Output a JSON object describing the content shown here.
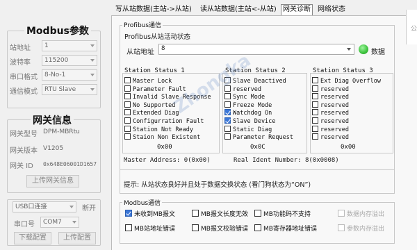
{
  "left": {
    "modbus_group": {
      "title": "Modbus参数",
      "fields": [
        {
          "label": "站地址",
          "value": "1"
        },
        {
          "label": "波特率",
          "value": "115200"
        },
        {
          "label": "串口格式",
          "value": "8-No-1"
        },
        {
          "label": "通信模式",
          "value": "RTU Slave"
        }
      ]
    },
    "gateway_group": {
      "title": "网关信息",
      "fields": [
        {
          "label": "网关型号",
          "value": "DPM-MBRtu"
        },
        {
          "label": "网关版本",
          "value": "V1205"
        },
        {
          "label": "网关 ID",
          "value": "0x648E06001D1657"
        }
      ],
      "upload_button": "上传网关信息"
    },
    "connection": {
      "connect_type": "USB口连接",
      "disconnect_button": "断开",
      "com_label": "串口号",
      "com_value": "COM7",
      "download_button": "下载配置",
      "upload_button": "上传配置"
    }
  },
  "tabs": [
    {
      "label": "写从站数据(主站->从站)"
    },
    {
      "label": "读从站数据(主站<-从站)"
    },
    {
      "label": "网关诊断"
    },
    {
      "label": "网络状态"
    }
  ],
  "profibus": {
    "title": "Profibus通信",
    "activity_title": "Profibus从站活动状态",
    "slave_addr_label": "从站地址",
    "slave_addr_value": "8",
    "data_label": "数据",
    "led_color": "#3cc23c",
    "status1": {
      "title": "Station Status 1",
      "items": [
        {
          "label": "Master Lock",
          "checked": false
        },
        {
          "label": "Parameter Fault",
          "checked": false
        },
        {
          "label": "Invalid Slave Response",
          "checked": false
        },
        {
          "label": "No Supported",
          "checked": false
        },
        {
          "label": "Extended Diag",
          "checked": false
        },
        {
          "label": "Configurration Fault",
          "checked": false
        },
        {
          "label": "Station Not Ready",
          "checked": false
        },
        {
          "label": "Staion Non Existent",
          "checked": false
        }
      ],
      "hex": "0x00"
    },
    "status2": {
      "title": "Station Status 2",
      "items": [
        {
          "label": "Slave Deactived",
          "checked": false
        },
        {
          "label": "reserved",
          "checked": false
        },
        {
          "label": "Sync Mode",
          "checked": false
        },
        {
          "label": "Freeze Mode",
          "checked": false
        },
        {
          "label": "Watchdog On",
          "checked": true
        },
        {
          "label": "Slave Device",
          "checked": true
        },
        {
          "label": "Static Diag",
          "checked": false
        },
        {
          "label": "Parameter Request",
          "checked": false
        }
      ],
      "hex": "0x0C"
    },
    "status3": {
      "title": "Station Status 3",
      "items": [
        {
          "label": "Ext Diag Overflow",
          "checked": false
        },
        {
          "label": "reserved",
          "checked": false
        },
        {
          "label": "reserved",
          "checked": false
        },
        {
          "label": "reserved",
          "checked": false
        },
        {
          "label": "reserved",
          "checked": false
        },
        {
          "label": "reserved",
          "checked": false
        },
        {
          "label": "reserved",
          "checked": false
        },
        {
          "label": "reserved",
          "checked": false
        }
      ],
      "hex": "0x00"
    },
    "master_address": "Master Address: 0(0x00)",
    "real_ident": "Real Ident Number: 8(0x0008)",
    "hint": "提示: 从站状态良好并且处于数据交换状态 (看门狗状态为“ON”)"
  },
  "modbus_comm": {
    "title": "Modbus通信",
    "items": [
      {
        "label": "未收到MB报文",
        "checked": true,
        "enabled": true
      },
      {
        "label": "MB报文长度无效",
        "checked": false,
        "enabled": true
      },
      {
        "label": "MB功能码不支持",
        "checked": false,
        "enabled": true
      },
      {
        "label": "数据内存溢出",
        "checked": false,
        "enabled": false
      },
      {
        "label": "MB站地址错误",
        "checked": false,
        "enabled": true
      },
      {
        "label": "MB报文校验错误",
        "checked": false,
        "enabled": true
      },
      {
        "label": "MB寄存器地址错误",
        "checked": false,
        "enabled": true
      },
      {
        "label": "参数内存溢出",
        "checked": false,
        "enabled": false
      }
    ]
  },
  "watermark": "Zhongka"
}
